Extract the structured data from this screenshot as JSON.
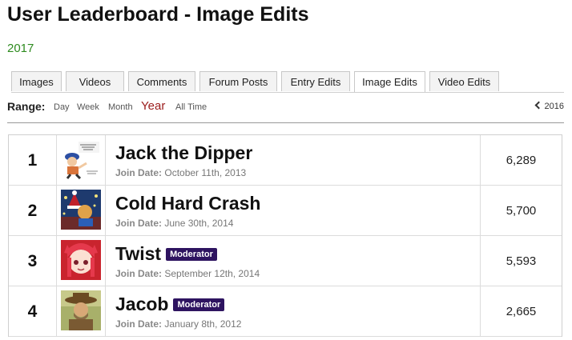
{
  "page": {
    "title": "User Leaderboard - Image Edits",
    "period": "2017"
  },
  "tabs": [
    {
      "label": "Images",
      "active": false
    },
    {
      "label": "Videos",
      "active": false
    },
    {
      "label": "Comments",
      "active": false
    },
    {
      "label": "Forum Posts",
      "active": false
    },
    {
      "label": "Entry Edits",
      "active": false
    },
    {
      "label": "Image Edits",
      "active": true
    },
    {
      "label": "Video Edits",
      "active": false
    }
  ],
  "range": {
    "label": "Range:",
    "options": [
      "Day",
      "Week",
      "Month",
      "Year",
      "All Time"
    ],
    "selected": "Year",
    "previous": "2016"
  },
  "leaderboard": {
    "join_label": "Join Date:",
    "badge_label": "Moderator",
    "rows": [
      {
        "rank": "1",
        "name": "Jack the Dipper",
        "moderator": false,
        "join_date": "October 11th, 2013",
        "count": "6,289"
      },
      {
        "rank": "2",
        "name": "Cold Hard Crash",
        "moderator": false,
        "join_date": "June 30th, 2014",
        "count": "5,700"
      },
      {
        "rank": "3",
        "name": "Twist",
        "moderator": true,
        "join_date": "September 12th, 2014",
        "count": "5,593"
      },
      {
        "rank": "4",
        "name": "Jacob",
        "moderator": true,
        "join_date": "January 8th, 2012",
        "count": "2,665"
      }
    ]
  },
  "colors": {
    "period_green": "#2e8b1f",
    "range_active": "#9b1c1c",
    "moderator_badge": "#2e1460"
  }
}
